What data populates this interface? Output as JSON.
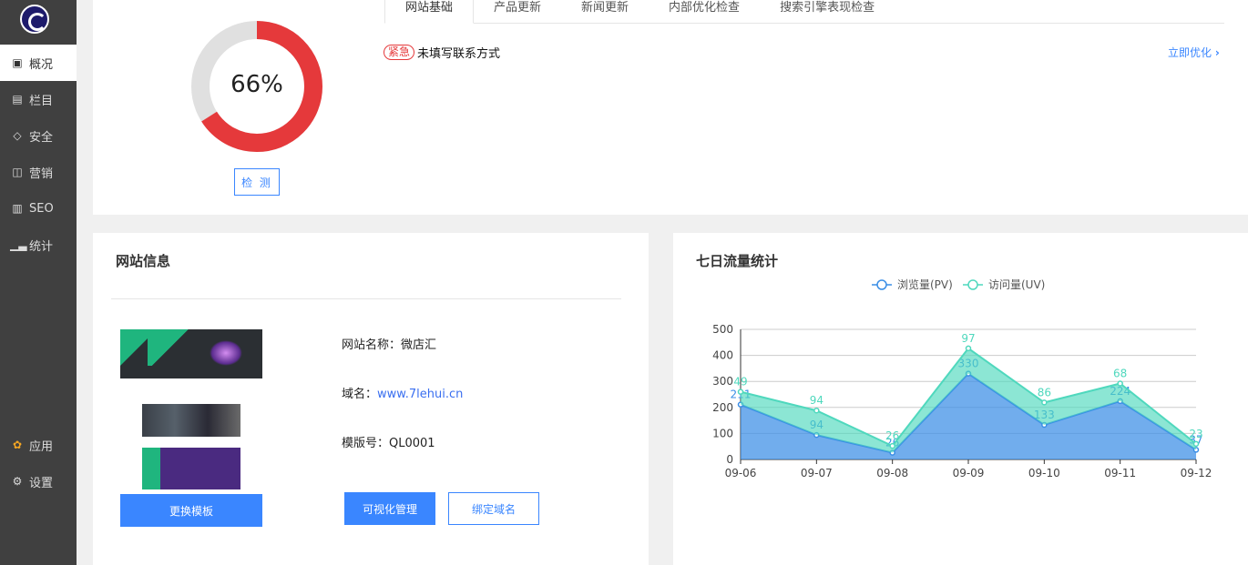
{
  "sidebar": {
    "items": [
      {
        "label": "概况",
        "icon": "dashboard-icon"
      },
      {
        "label": "栏目",
        "icon": "document-icon"
      },
      {
        "label": "安全",
        "icon": "tag-icon"
      },
      {
        "label": "营销",
        "icon": "book-icon"
      },
      {
        "label": "SEO",
        "icon": "printer-icon"
      },
      {
        "label": "统计",
        "icon": "bar-chart-icon"
      }
    ],
    "bottom": [
      {
        "label": "应用",
        "icon": "apps-icon"
      },
      {
        "label": "设置",
        "icon": "gear-icon"
      }
    ]
  },
  "score": {
    "percent": 66,
    "label": "66%",
    "detect_label": "检 测",
    "colors": {
      "filled": "#e5393b",
      "empty": "#e0e0e0"
    }
  },
  "tabs": [
    "网站基础",
    "产品更新",
    "新闻更新",
    "内部优化检查",
    "搜索引擎表现检查"
  ],
  "issue": {
    "badge": "紧急",
    "text": "未填写联系方式",
    "action": "立即优化"
  },
  "site_info": {
    "title": "网站信息",
    "name_label": "网站名称：",
    "name": "微店汇",
    "domain_label": "域名：",
    "domain": "www.7lehui.cn",
    "template_label": "模版号：",
    "template": "QL0001",
    "change_template": "更换模板",
    "visual_manage": "可视化管理",
    "bind_domain": "绑定域名"
  },
  "chart_data": {
    "type": "area",
    "title": "七日流量统计",
    "stacked": true,
    "x": [
      "09-06",
      "09-07",
      "09-08",
      "09-09",
      "09-10",
      "09-11",
      "09-12"
    ],
    "series": [
      {
        "name": "浏览量(PV)",
        "values": [
          211,
          94,
          26,
          330,
          133,
          224,
          37
        ],
        "color": "#3a8ee6"
      },
      {
        "name": "访问量(UV)",
        "values": [
          49,
          94,
          26,
          97,
          86,
          68,
          23
        ],
        "color": "#4fd8bd"
      }
    ],
    "ylim": [
      0,
      500
    ],
    "yticks": [
      0,
      100,
      200,
      300,
      400,
      500
    ],
    "grid": true,
    "legend": "top-center"
  }
}
